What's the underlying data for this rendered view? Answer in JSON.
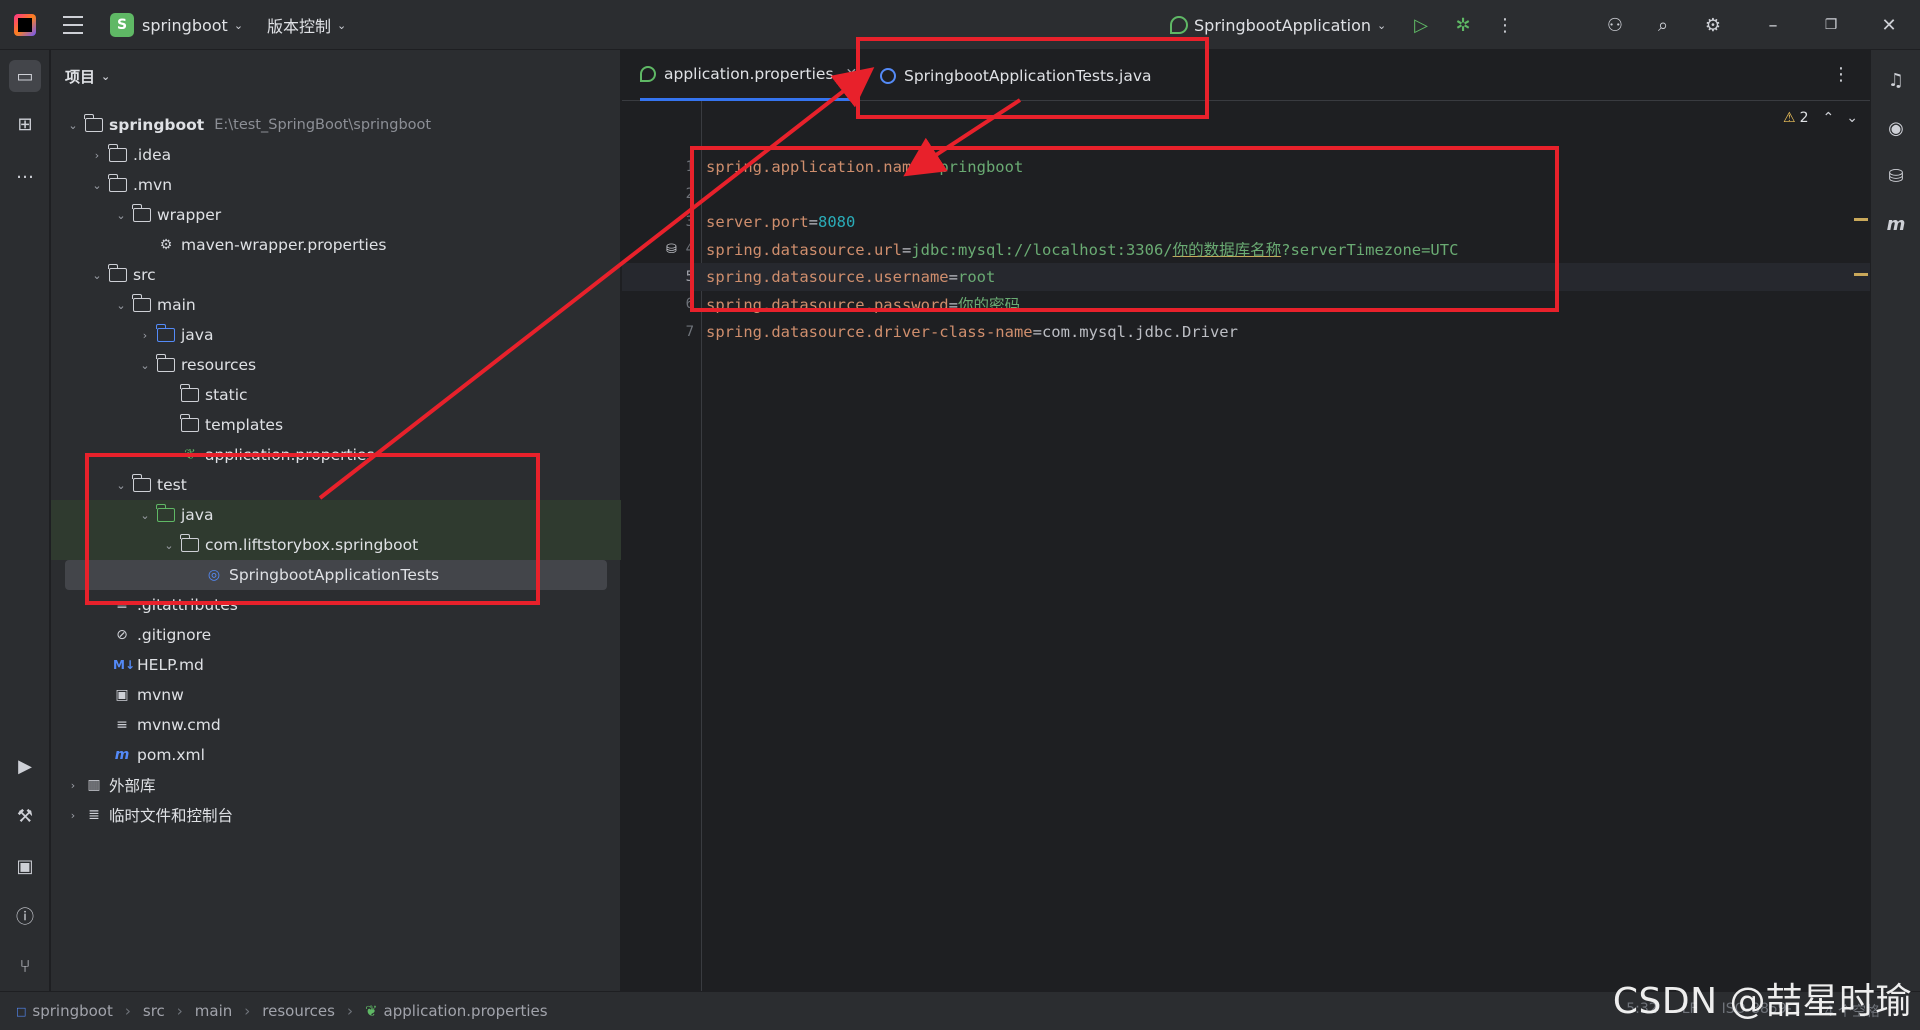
{
  "titlebar": {
    "project_badge": "S",
    "project_name": "springboot",
    "vcs_label": "版本控制",
    "run_config": "SpringbootApplication"
  },
  "project_panel": {
    "header": "项目",
    "tree": [
      {
        "label": "springboot",
        "path": "E:\\test_SpringBoot\\springboot"
      },
      {
        "label": ".idea"
      },
      {
        "label": ".mvn"
      },
      {
        "label": "wrapper"
      },
      {
        "label": "maven-wrapper.properties"
      },
      {
        "label": "src"
      },
      {
        "label": "main"
      },
      {
        "label": "java"
      },
      {
        "label": "resources"
      },
      {
        "label": "static"
      },
      {
        "label": "templates"
      },
      {
        "label": "application.properties"
      },
      {
        "label": "test"
      },
      {
        "label": "java"
      },
      {
        "label": "com.liftstorybox.springboot"
      },
      {
        "label": "SpringbootApplicationTests"
      },
      {
        "label": ".gitattributes"
      },
      {
        "label": ".gitignore"
      },
      {
        "label": "HELP.md"
      },
      {
        "label": "mvnw"
      },
      {
        "label": "mvnw.cmd"
      },
      {
        "label": "pom.xml"
      },
      {
        "label": "外部库"
      },
      {
        "label": "临时文件和控制台"
      }
    ]
  },
  "editor": {
    "tabs": [
      {
        "label": "application.properties"
      },
      {
        "label": "SpringbootApplicationTests.java"
      }
    ],
    "warnings_count": "2",
    "lines": [
      {
        "num": "1",
        "key": "spring.application.name",
        "eq": "=",
        "val": "springboot"
      },
      {
        "num": "2"
      },
      {
        "num": "3",
        "key": "server.port",
        "eq": "=",
        "val": "8080"
      },
      {
        "num": "4",
        "key": "spring.datasource.url",
        "eq": "=",
        "val_a": "jdbc:mysql://localhost:3306/",
        "val_b": "你的数据库名称",
        "val_c": "?serverTimezone=UTC"
      },
      {
        "num": "5",
        "key": "spring.datasource.username",
        "eq": "=",
        "val": "root"
      },
      {
        "num": "6",
        "key": "spring.datasource.password",
        "eq": "=",
        "val": "你的密码"
      },
      {
        "num": "7",
        "key": "spring.datasource.driver-class-name",
        "eq": "=",
        "val": "com.mysql.jdbc.Driver"
      }
    ]
  },
  "statusbar": {
    "breadcrumbs": [
      "springboot",
      "src",
      "main",
      "resources",
      "application.properties"
    ],
    "position": "5:32",
    "line_sep": "LF",
    "encoding": "ISO-8859-1",
    "indent": "4 个空格"
  },
  "watermark": "CSDN @喆星时瑜",
  "colors": {
    "accent": "#3574f0",
    "annotation_red": "#e8212b"
  }
}
